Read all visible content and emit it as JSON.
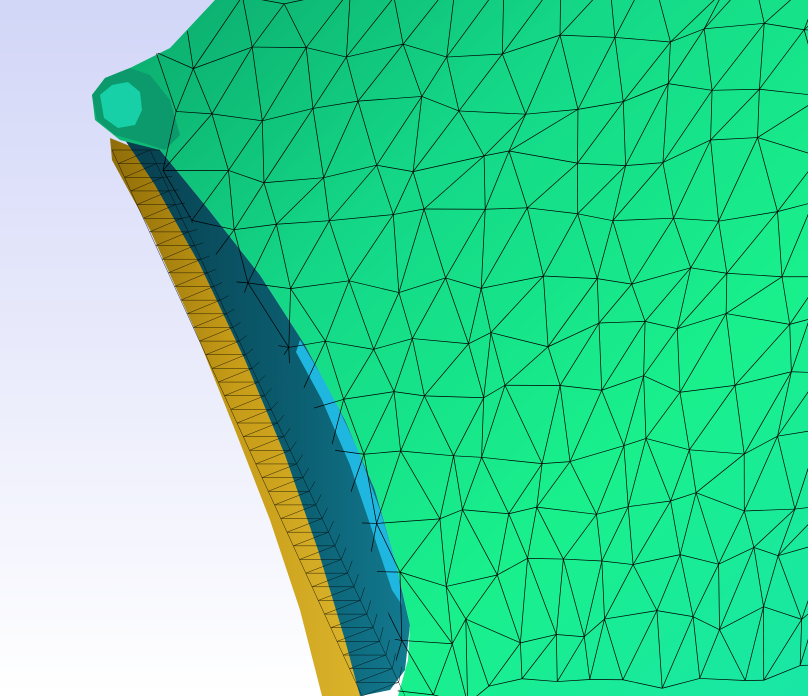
{
  "viewer": {
    "background_top": "#d2d6f7",
    "background_bottom": "#ffffff"
  },
  "mesh": {
    "surface_color_light": "#19f58a",
    "surface_color_dark": "#0aa66a",
    "surface_color_mid": "#19e49e",
    "inner_face_color": "#0b5e70",
    "inner_face_highlight": "#1fb7e0",
    "edge_face_color": "#b88f12",
    "edge_face_light": "#d8b22a",
    "wireframe_color": "#000000"
  }
}
